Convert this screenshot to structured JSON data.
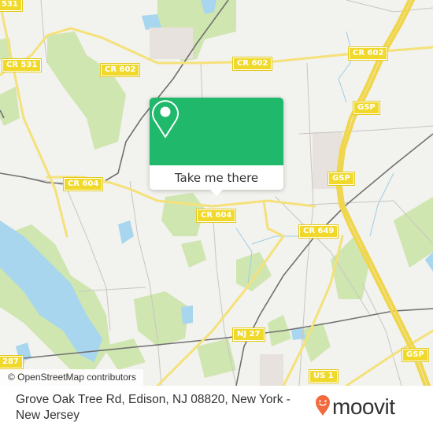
{
  "map": {
    "attribution": "© OpenStreetMap contributors",
    "road_labels": [
      {
        "id": "cr531-top",
        "text": "531"
      },
      {
        "id": "cr531",
        "text": "CR 531"
      },
      {
        "id": "cr602-west",
        "text": "CR 602"
      },
      {
        "id": "cr602-mid",
        "text": "CR 602"
      },
      {
        "id": "cr602-east",
        "text": "CR 602"
      },
      {
        "id": "gsp-north",
        "text": "GSP"
      },
      {
        "id": "gsp-mid",
        "text": "GSP"
      },
      {
        "id": "cr604-west",
        "text": "CR 604"
      },
      {
        "id": "cr604-center",
        "text": "CR 604"
      },
      {
        "id": "cr649",
        "text": "CR 649"
      },
      {
        "id": "nj27",
        "text": "NJ 27"
      },
      {
        "id": "gsp-south",
        "text": "GSP"
      },
      {
        "id": "us1",
        "text": "US 1"
      },
      {
        "id": "r287",
        "text": "287"
      }
    ]
  },
  "popup": {
    "icon": "map-pin-icon",
    "button_label": "Take me there",
    "color": "#20b86a"
  },
  "footer": {
    "address": "Grove Oak Tree Rd, Edison, NJ 08820, New York - New Jersey",
    "logo_text": "moovit",
    "logo_color": "#f26a3d"
  }
}
